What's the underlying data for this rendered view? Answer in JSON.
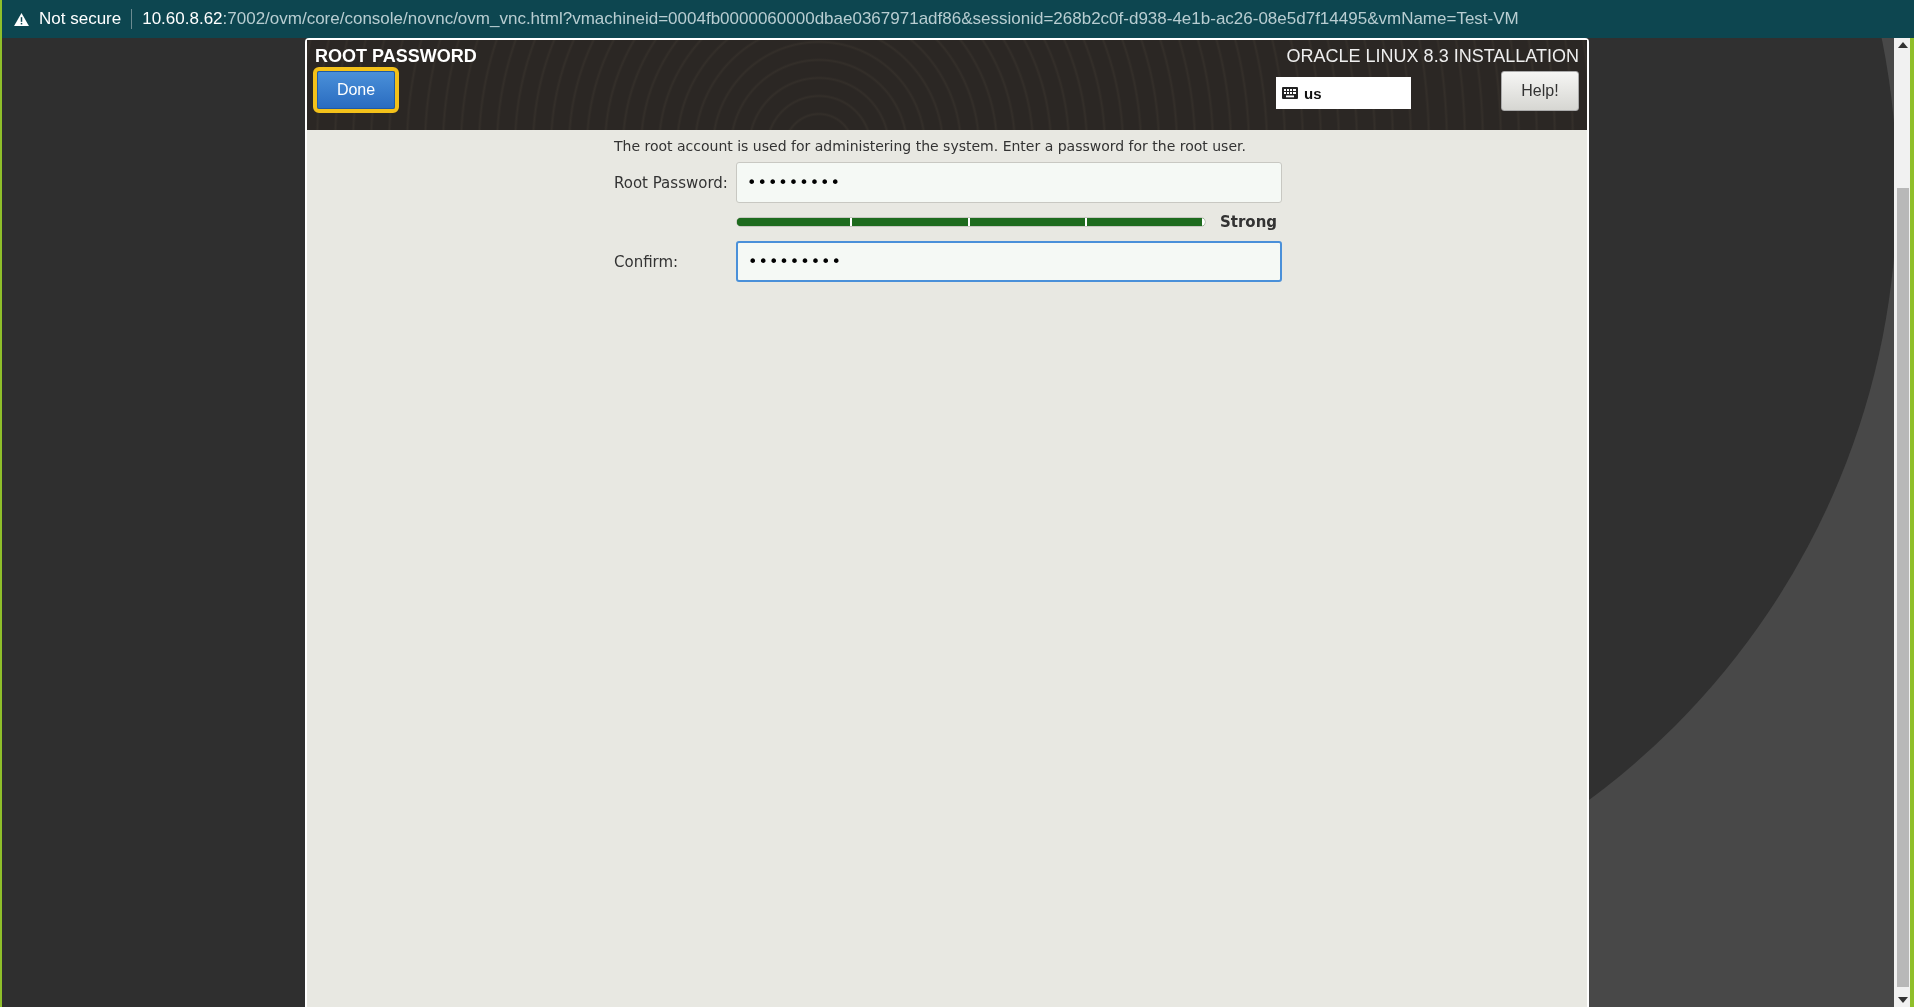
{
  "browser": {
    "security": "Not secure",
    "url_host": "10.60.8.62",
    "url_rest": ":7002/ovm/core/console/novnc/ovm_vnc.html?vmachineid=0004fb0000060000dbae0367971adf86&sessionid=268b2c0f-d938-4e1b-ac26-08e5d7f14495&vmName=Test-VM"
  },
  "installer": {
    "spoke_title": "ROOT PASSWORD",
    "done_button": {
      "label": "Done",
      "focused": true
    },
    "product_title": "ORACLE LINUX 8.3 INSTALLATION",
    "keyboard_layout": "us",
    "help_button": "Help!"
  },
  "form": {
    "description": "The root account is used for administering the system.  Enter a password for the root user.",
    "fields": [
      {
        "label": "Root Password:",
        "value": "•••••••••",
        "focused": false
      },
      {
        "label": "Confirm:",
        "value": "•••••••••",
        "focused": true
      }
    ],
    "strength": {
      "level": 1.0,
      "label": "Strong"
    }
  }
}
